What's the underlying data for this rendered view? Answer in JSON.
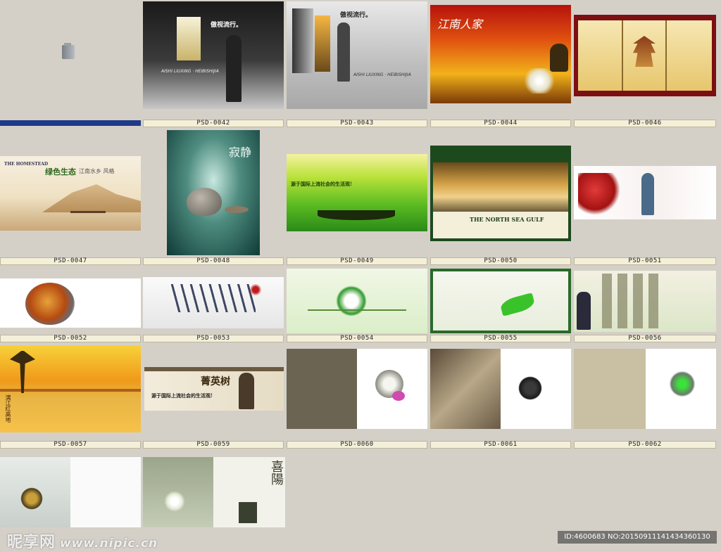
{
  "labels": {
    "l0042": "PSD-0042",
    "l0043": "PSD-0043",
    "l0044": "PSD-0044",
    "l0046": "PSD-0046",
    "l0047": "PSD-0047",
    "l0048": "PSD-0048",
    "l0049": "PSD-0049",
    "l0050": "PSD-0050",
    "l0051": "PSD-0051",
    "l0052": "PSD-0052",
    "l0053": "PSD-0053",
    "l0054": "PSD-0054",
    "l0055": "PSD-0055",
    "l0056": "PSD-0056",
    "l0057": "PSD-0057",
    "l0059": "PSD-0059",
    "l0060": "PSD-0060",
    "l0061": "PSD-0061",
    "l0062": "PSD-0062"
  },
  "thumbs": {
    "t0042": {
      "title": "傲视流行。",
      "sub": "AISHI LIUXING · HEIBISHIJIA"
    },
    "t0043": {
      "title": "傲视流行。",
      "sub": "AISHI LIUXING · HEIBISHIJIA"
    },
    "t0044": {
      "title": "江南人家"
    },
    "t0047": {
      "sub": "THE HOMESTEAD",
      "title": "绿色生态",
      "tag": "江南水乡 风格"
    },
    "t0048": {
      "title": "寂静"
    },
    "t0049": {
      "title": "源于国际上流社会的生活观!"
    },
    "t0050": {
      "title": "THE NORTH SEA GULF"
    },
    "t0057": {
      "title": "漓江红高地"
    },
    "t0059": {
      "title": "菁英树",
      "sub": "源于国际上流社会的生活观!"
    },
    "t0063": {
      "title": "喜陽"
    }
  },
  "watermark": {
    "text": "昵享网",
    "url": "www.nipic.cn"
  },
  "image_id": "ID:4600683 NO:20150911141434360130"
}
